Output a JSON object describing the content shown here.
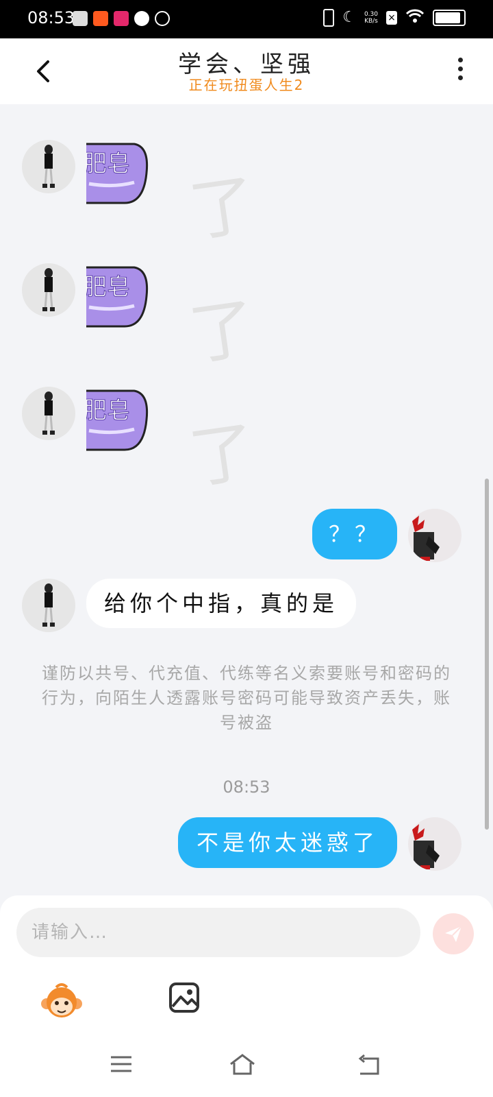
{
  "status_bar": {
    "time": "08:53",
    "net_speed_value": "0.30",
    "net_speed_unit": "KB/s"
  },
  "header": {
    "title": "学会、坚强",
    "subtitle": "正在玩扭蛋人生2"
  },
  "messages": [
    {
      "side": "left",
      "type": "sticker",
      "sticker_text": "肥皂",
      "decor": "了"
    },
    {
      "side": "left",
      "type": "sticker",
      "sticker_text": "肥皂",
      "decor": "了"
    },
    {
      "side": "left",
      "type": "sticker",
      "sticker_text": "肥皂",
      "decor": "了"
    },
    {
      "side": "right",
      "type": "text",
      "text": "？？"
    },
    {
      "side": "left",
      "type": "text",
      "text": "给你个中指，真的是"
    },
    {
      "side": "right",
      "type": "text",
      "text": "不是你太迷惑了"
    }
  ],
  "notice": "谨防以共号、代充值、代练等名义索要账号和密码的行为，向陌生人透露账号密码可能导致资产丢失，账号被盗",
  "time_divider": "08:53",
  "input": {
    "placeholder": "请输入…",
    "value": ""
  },
  "colors": {
    "my_bubble": "#27b4f7",
    "subtitle": "#f08a1c",
    "sticker": "#a98fe8",
    "send_button": "#fde0de"
  },
  "icons": {
    "back": "chevron-left-icon",
    "more": "more-vertical-icon",
    "send": "send-icon",
    "emoji": "monkey-emoji-icon",
    "image": "image-icon",
    "nav_menu": "menu-icon",
    "nav_home": "home-icon",
    "nav_back": "back-icon"
  }
}
